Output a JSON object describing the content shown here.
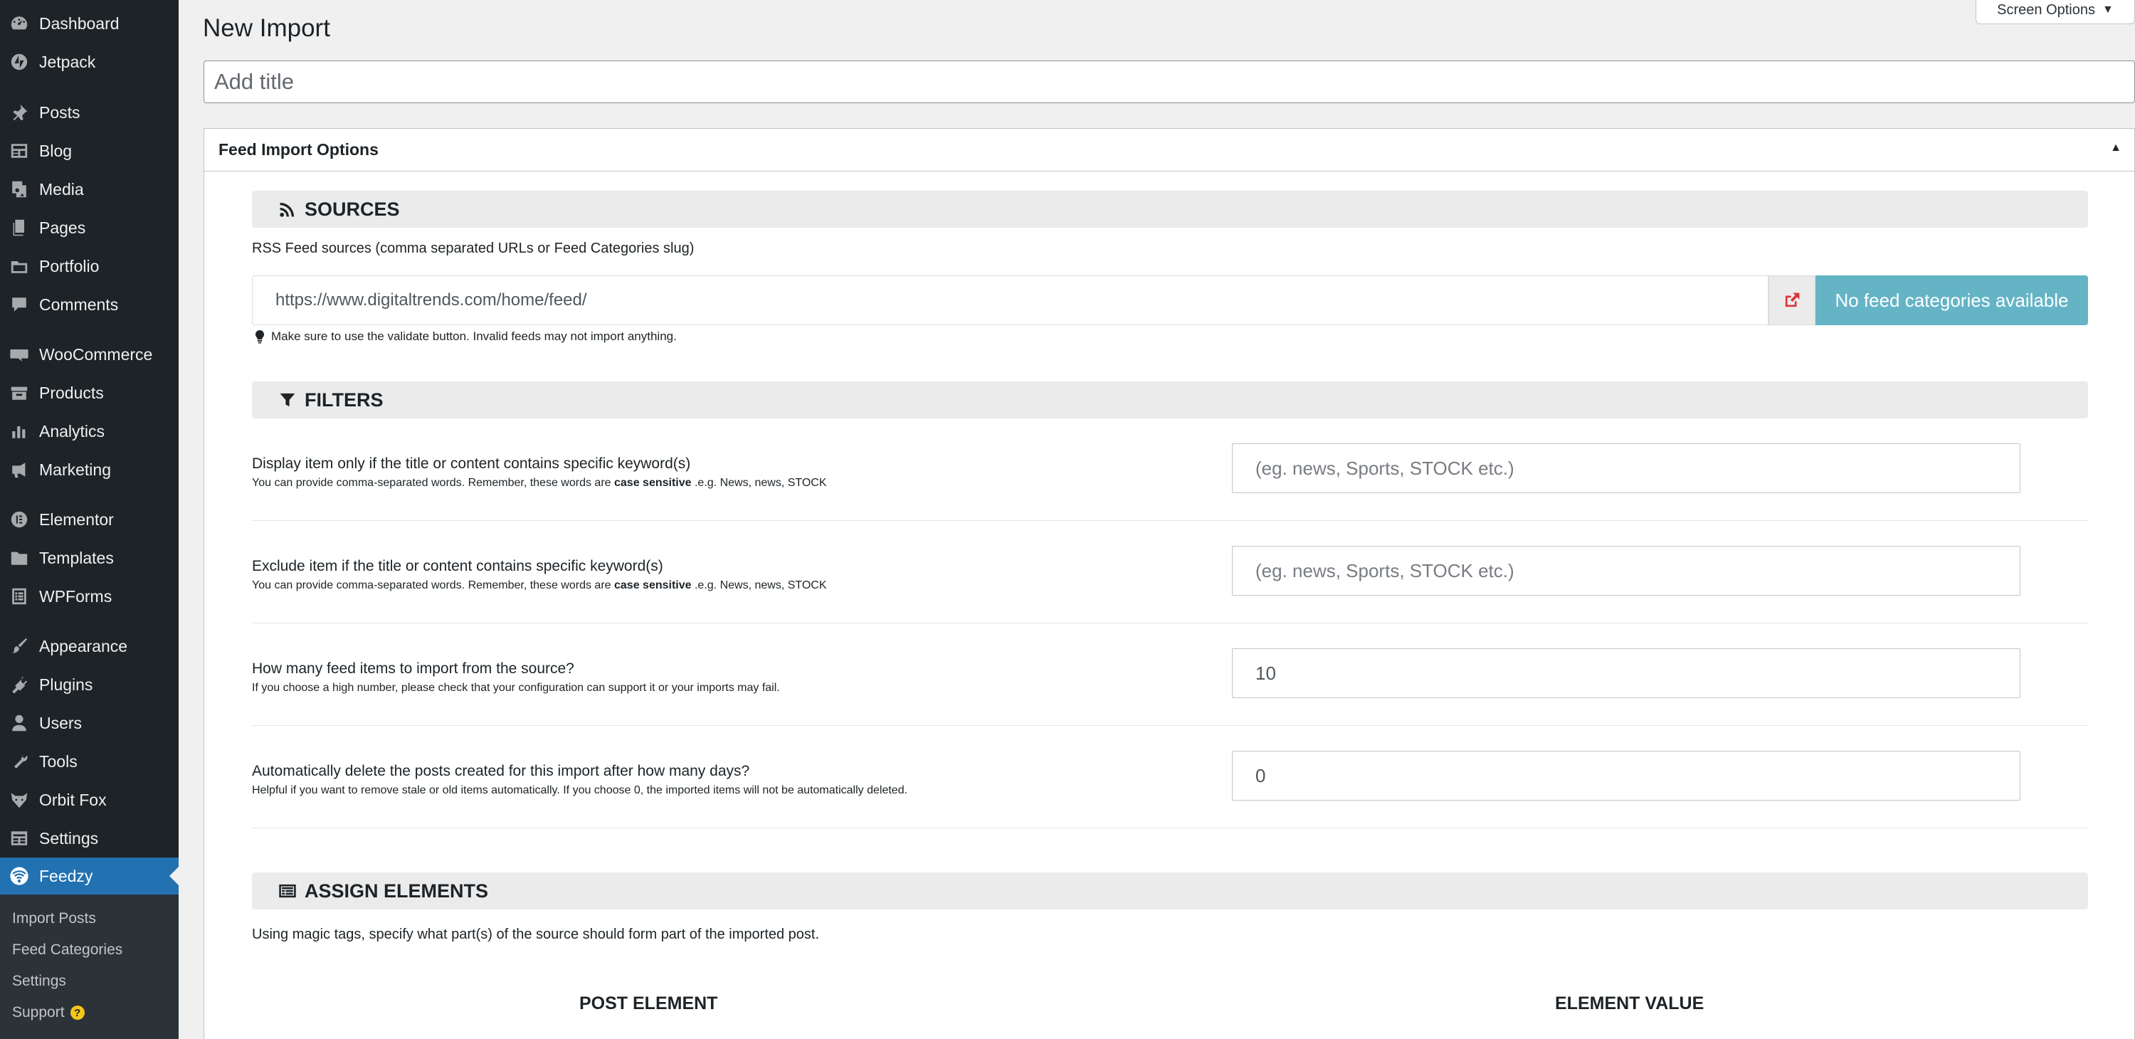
{
  "sidebar": {
    "items": [
      {
        "label": "Dashboard",
        "icon": "dashboard-icon"
      },
      {
        "label": "Jetpack",
        "icon": "jetpack-icon"
      },
      {
        "label": "Posts",
        "icon": "pin-icon"
      },
      {
        "label": "Blog",
        "icon": "blog-icon"
      },
      {
        "label": "Media",
        "icon": "media-icon"
      },
      {
        "label": "Pages",
        "icon": "pages-icon"
      },
      {
        "label": "Portfolio",
        "icon": "portfolio-icon"
      },
      {
        "label": "Comments",
        "icon": "comments-icon"
      },
      {
        "label": "WooCommerce",
        "icon": "woocommerce-icon"
      },
      {
        "label": "Products",
        "icon": "products-icon"
      },
      {
        "label": "Analytics",
        "icon": "analytics-icon"
      },
      {
        "label": "Marketing",
        "icon": "megaphone-icon"
      },
      {
        "label": "Elementor",
        "icon": "elementor-icon"
      },
      {
        "label": "Templates",
        "icon": "folder-icon"
      },
      {
        "label": "WPForms",
        "icon": "forms-icon"
      },
      {
        "label": "Appearance",
        "icon": "brush-icon"
      },
      {
        "label": "Plugins",
        "icon": "plug-icon"
      },
      {
        "label": "Users",
        "icon": "user-icon"
      },
      {
        "label": "Tools",
        "icon": "wrench-icon"
      },
      {
        "label": "Orbit Fox",
        "icon": "fox-icon"
      },
      {
        "label": "Settings",
        "icon": "settings-icon"
      },
      {
        "label": "Feedzy",
        "icon": "feedzy-icon"
      }
    ],
    "submenu": [
      {
        "label": "Import Posts"
      },
      {
        "label": "Feed Categories"
      },
      {
        "label": "Settings"
      },
      {
        "label": "Support"
      }
    ],
    "support_badge": "?"
  },
  "header": {
    "title": "New Import",
    "screen_options": "Screen Options",
    "screen_options_caret": "▼",
    "title_placeholder": "Add title"
  },
  "metabox": {
    "title": "Feed Import Options",
    "toggle": "▲"
  },
  "sources": {
    "heading": "SOURCES",
    "label": "RSS Feed sources (comma separated URLs or Feed Categories slug)",
    "feed_url": "https://www.digitaltrends.com/home/feed/",
    "categories_button": "No feed categories available",
    "hint": "Make sure to use the validate button. Invalid feeds may not import anything."
  },
  "filters": {
    "heading": "FILTERS",
    "rows": [
      {
        "label": "Display item only if the title or content contains specific keyword(s)",
        "help_pre": "You can provide comma-separated words. Remember, these words are",
        "help_bold": "case sensitive",
        "help_post": ".e.g. News, news, STOCK",
        "placeholder": "(eg. news, Sports, STOCK etc.)",
        "value": ""
      },
      {
        "label": "Exclude item if the title or content contains specific keyword(s)",
        "help_pre": "You can provide comma-separated words. Remember, these words are",
        "help_bold": "case sensitive",
        "help_post": ".e.g. News, news, STOCK",
        "placeholder": "(eg. news, Sports, STOCK etc.)",
        "value": ""
      },
      {
        "label": "How many feed items to import from the source?",
        "help_pre": "If you choose a high number, please check that your configuration can support it or your imports may fail.",
        "help_bold": "",
        "help_post": "",
        "placeholder": "",
        "value": "10"
      },
      {
        "label": "Automatically delete the posts created for this import after how many days?",
        "help_pre": "Helpful if you want to remove stale or old items automatically. If you choose 0, the imported items will not be automatically deleted.",
        "help_bold": "",
        "help_post": "",
        "placeholder": "",
        "value": "0"
      }
    ]
  },
  "assign": {
    "heading": "ASSIGN ELEMENTS",
    "description": "Using magic tags, specify what part(s) of the source should form part of the imported post.",
    "col_post_element": "POST ELEMENT",
    "col_element_value": "ELEMENT VALUE"
  },
  "colors": {
    "sidebar_bg": "#1d2327",
    "active_bg": "#2271b1",
    "categories_button_bg": "#64b4c6",
    "validate_icon": "#d63638"
  }
}
